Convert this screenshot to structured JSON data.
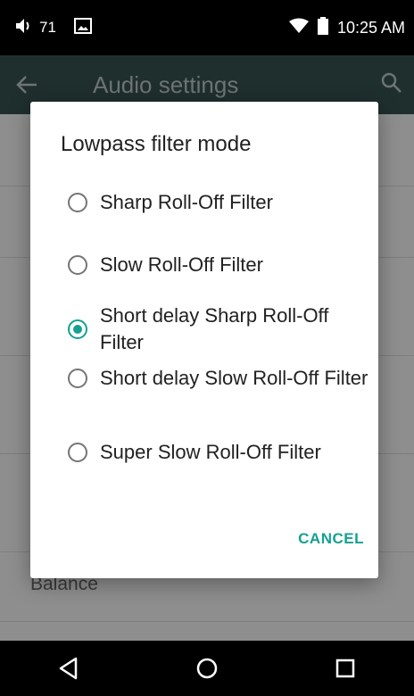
{
  "status_bar": {
    "volume_level": "71",
    "time": "10:25 AM"
  },
  "app_bar": {
    "title": "Audio settings"
  },
  "background": {
    "visible_item": "Balance"
  },
  "dialog": {
    "title": "Lowpass filter mode",
    "options": [
      {
        "label": "Sharp Roll-Off Filter",
        "selected": false
      },
      {
        "label": "Slow Roll-Off Filter",
        "selected": false
      },
      {
        "label": "Short delay Sharp Roll-Off Filter",
        "selected": true
      },
      {
        "label": "Short delay Slow Roll-Off Filter",
        "selected": false
      },
      {
        "label": "Super Slow Roll-Off Filter",
        "selected": false
      }
    ],
    "cancel_label": "CANCEL"
  },
  "colors": {
    "accent": "#14a192"
  }
}
